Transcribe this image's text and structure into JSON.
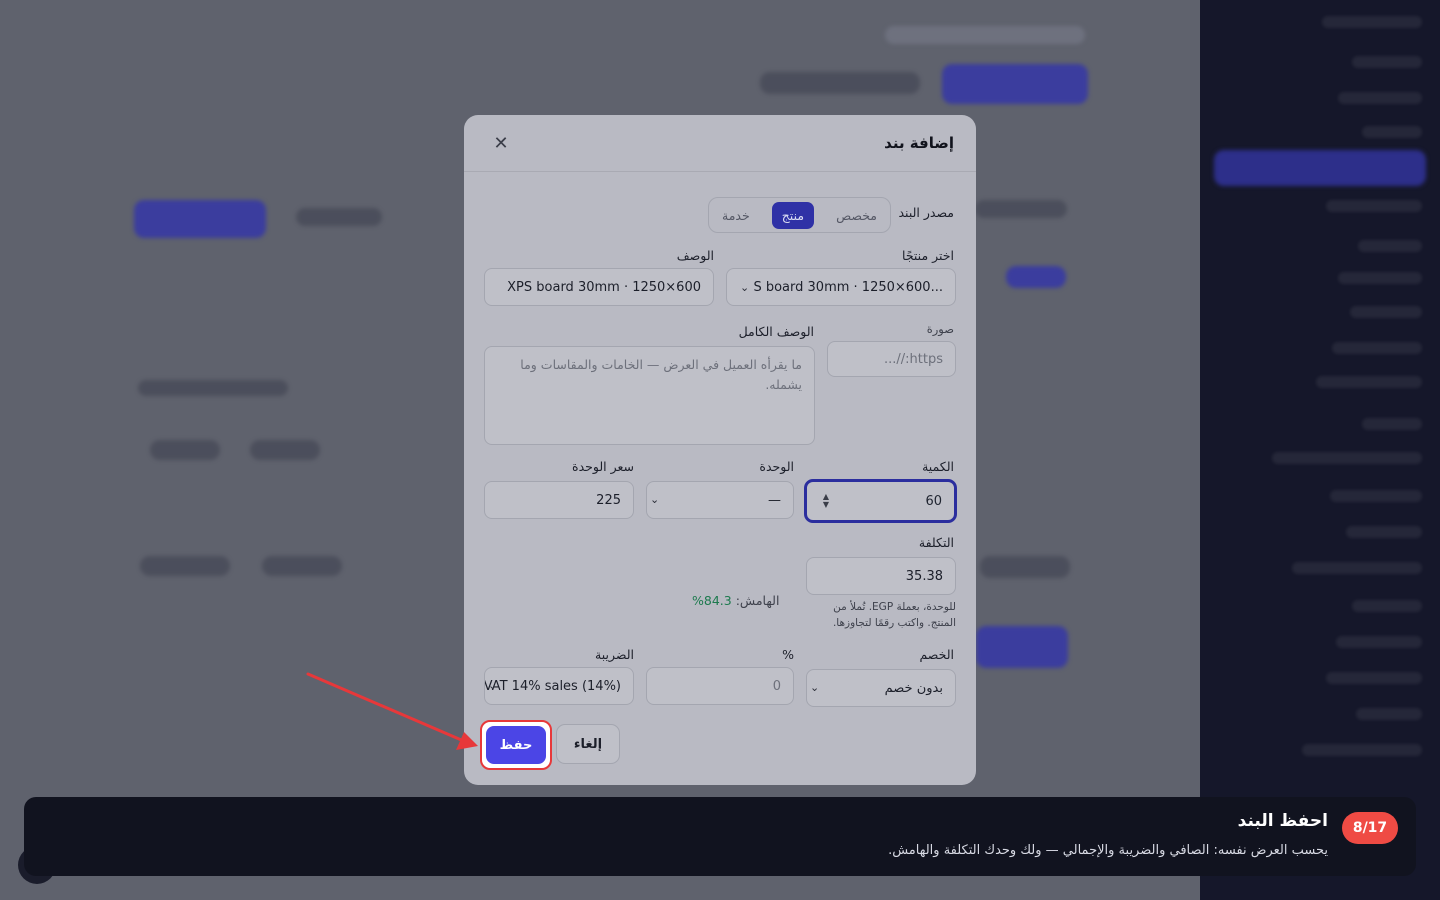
{
  "modal": {
    "title": "إضافة بند",
    "close_icon": "close-icon",
    "source": {
      "label": "مصدر البند",
      "options": [
        "مخصص",
        "منتج",
        "خدمة"
      ],
      "selected": "منتج"
    },
    "product": {
      "label": "اختر منتجًا",
      "value": "...S board 30mm · 1250×600"
    },
    "description": {
      "label": "الوصف",
      "value": "XPS board 30mm · 1250×600"
    },
    "image": {
      "label": "صورة",
      "placeholder": "https://..."
    },
    "full_description": {
      "label": "الوصف الكامل",
      "placeholder": "ما يقرأه العميل في العرض — الخامات والمقاسات وما يشمله."
    },
    "quantity": {
      "label": "الكمية",
      "value": "60"
    },
    "unit": {
      "label": "الوحدة",
      "value": "—"
    },
    "unit_price": {
      "label": "سعر الوحدة",
      "value": "225"
    },
    "cost": {
      "label": "التكلفة",
      "value": "35.38",
      "help": "للوحدة، بعملة EGP. تُملأ من المنتج. واكتب رقمًا لتجاوزها."
    },
    "margin": {
      "label": "الهامش:",
      "value": "84.3%"
    },
    "discount": {
      "label": "الخصم",
      "value": "بدون خصم"
    },
    "percent": {
      "label": "%",
      "value": "0"
    },
    "tax": {
      "label": "الضريبة",
      "value": "VAT 14% sales (14%)"
    },
    "save_label": "حفظ",
    "cancel_label": "إلغاء"
  },
  "tour": {
    "step": "8/17",
    "title": "احفظ البند",
    "description": "يحسب العرض نفسه: الصافي والضريبة والإجمالي — ولك وحدك التكلفة والهامش."
  },
  "colors": {
    "accent": "#4b45e6",
    "highlight": "#e7383a",
    "margin_positive": "#1d7a4e",
    "tour_bg": "#11131f",
    "badge": "#ef4b44"
  }
}
